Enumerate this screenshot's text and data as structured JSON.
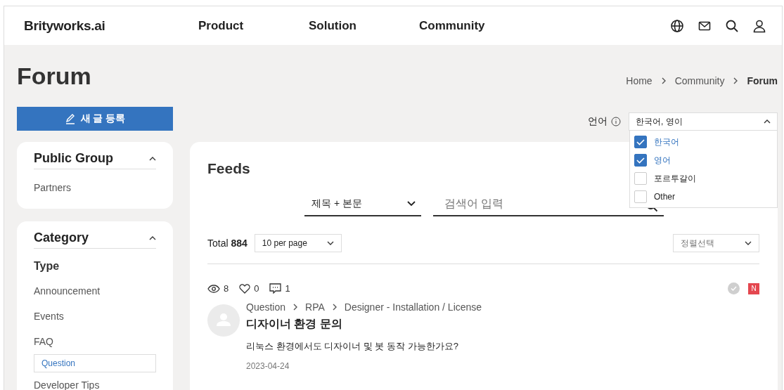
{
  "header": {
    "logo": "Brityworks.ai",
    "nav": [
      {
        "label": "Product"
      },
      {
        "label": "Solution"
      },
      {
        "label": "Community"
      }
    ]
  },
  "page": {
    "title": "Forum",
    "breadcrumb": [
      "Home",
      "Community",
      "Forum"
    ]
  },
  "new_post_button": "새 글 등록",
  "language": {
    "label": "언어",
    "value": "한국어, 영이",
    "expanded": true,
    "options": [
      {
        "label": "한국어",
        "checked": true
      },
      {
        "label": "영어",
        "checked": true
      },
      {
        "label": "포르투갈이",
        "checked": false
      },
      {
        "label": "Other",
        "checked": false
      }
    ]
  },
  "sidebar": {
    "groups": [
      {
        "title": "Public Group",
        "expanded": true,
        "items": [
          {
            "label": "Partners",
            "kind": "link",
            "selected": false
          }
        ]
      },
      {
        "title": "Category",
        "expanded": true,
        "items": [
          {
            "label": "Type",
            "kind": "heading",
            "selected": false
          },
          {
            "label": "Announcement",
            "kind": "link",
            "selected": false
          },
          {
            "label": "Events",
            "kind": "link",
            "selected": false
          },
          {
            "label": "FAQ",
            "kind": "link",
            "selected": false
          },
          {
            "label": "Question",
            "kind": "link",
            "selected": true
          },
          {
            "label": "Developer Tips",
            "kind": "link",
            "selected": false
          }
        ]
      }
    ]
  },
  "feeds": {
    "title": "Feeds",
    "search_scope": "제목 + 본문",
    "search": {
      "placeholder": "검색어 입력"
    },
    "total_label": "Total",
    "total": "884",
    "per_page": "10 per page",
    "sort": {
      "placeholder": "정렬선택"
    },
    "posts": [
      {
        "views": "8",
        "likes": "0",
        "comments": "1",
        "answered": false,
        "badge": "N",
        "path": [
          "Question",
          "RPA",
          "Designer - Installation / License"
        ],
        "title": "디자이너 환경 문의",
        "body": "리눅스 환경에서도 디자이너 및 봇 동작 가능한가요?",
        "date": "2023-04-24"
      }
    ]
  }
}
